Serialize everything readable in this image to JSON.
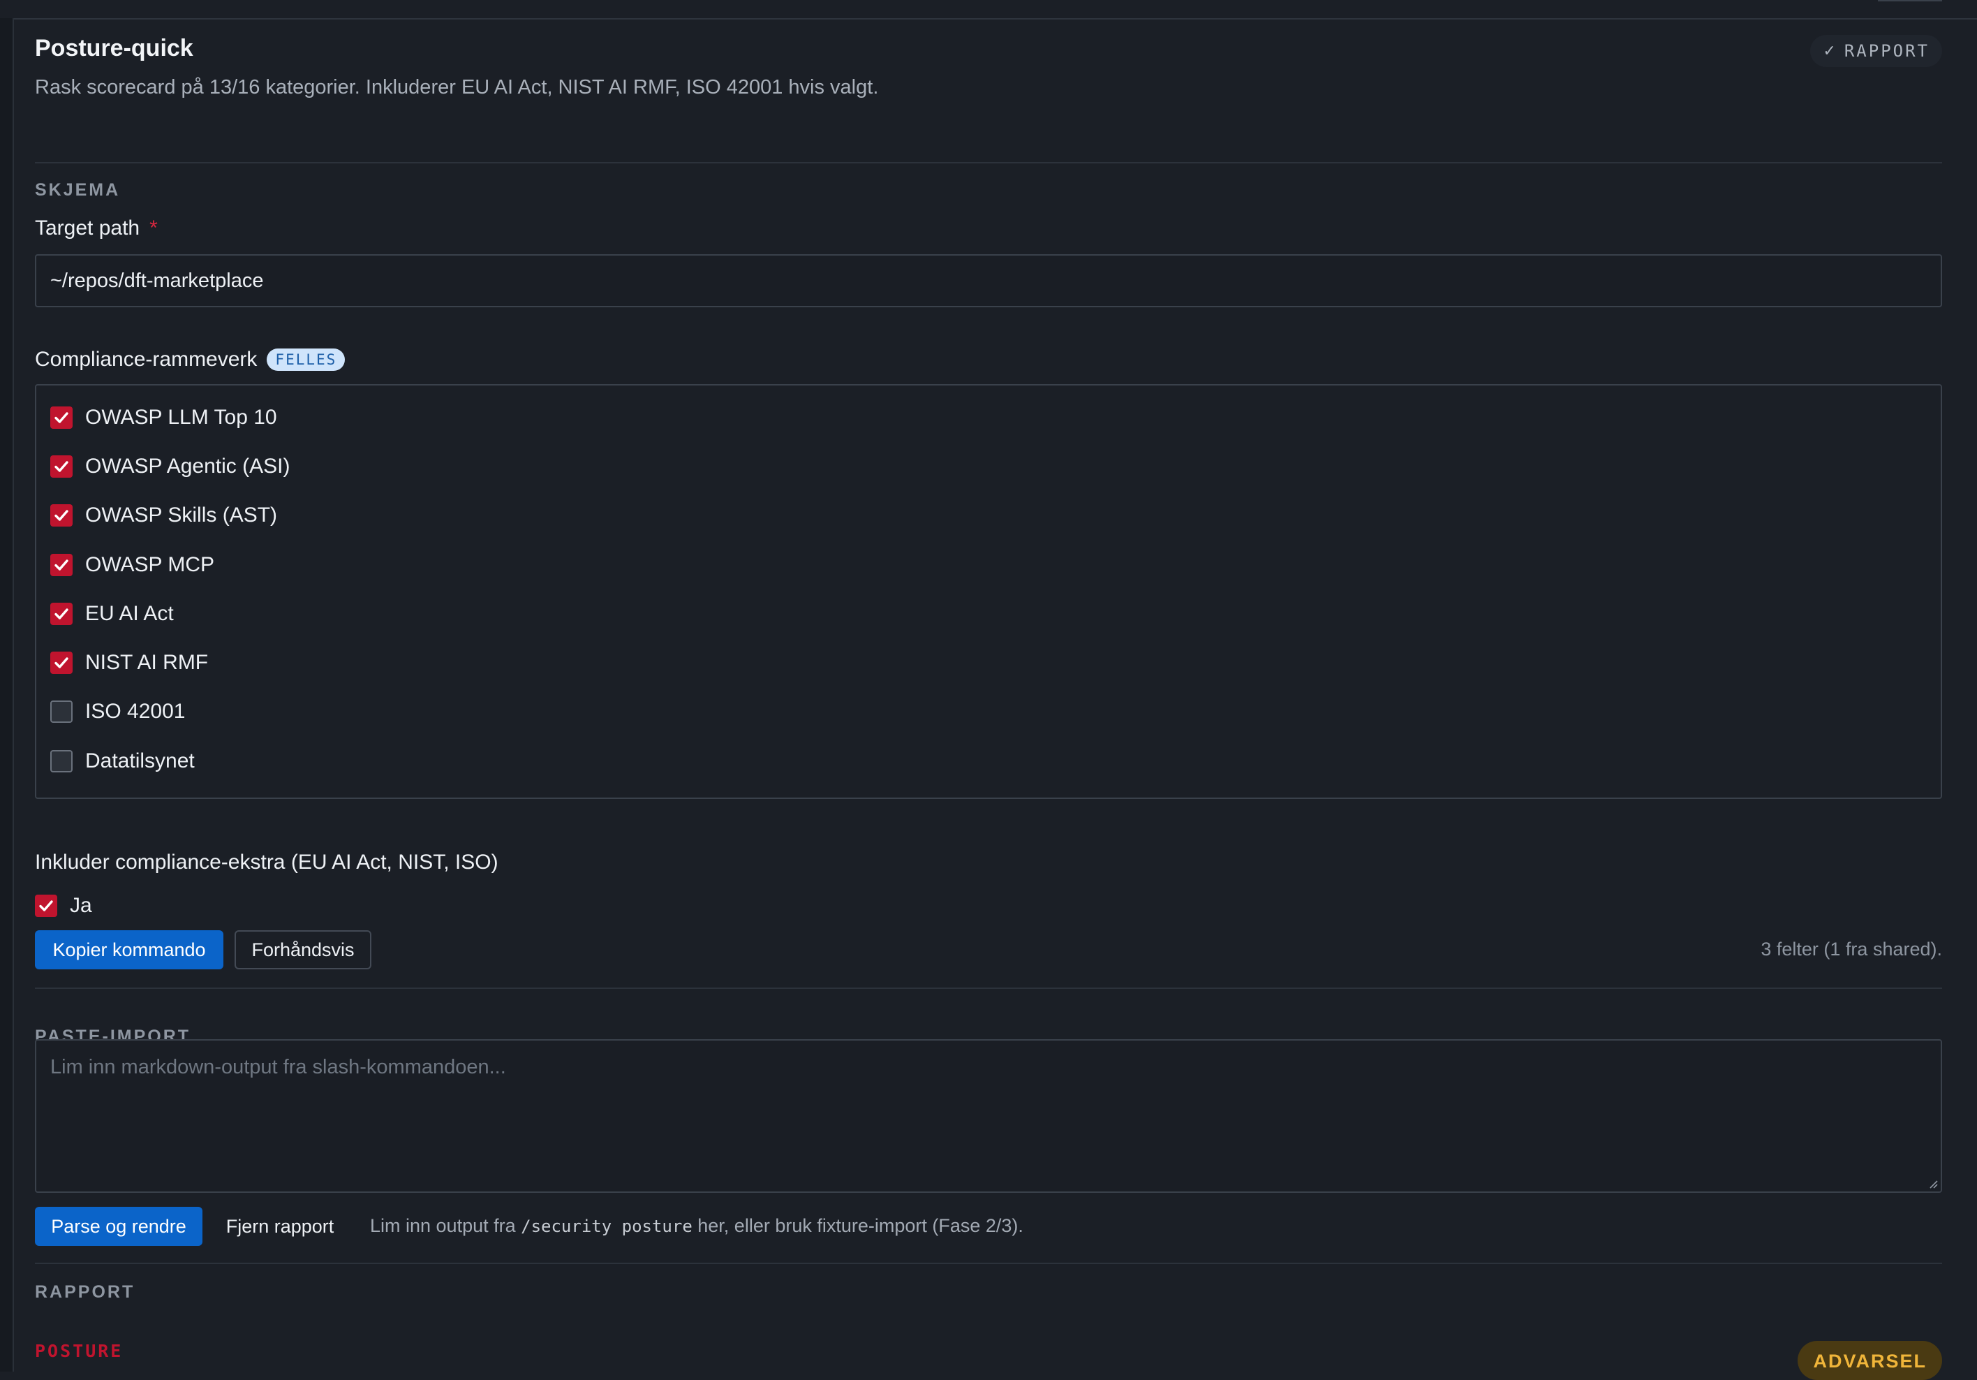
{
  "card": {
    "title": "Posture-quick",
    "subtitle": "Rask scorecard på 13/16 kategorier. Inkluderer EU AI Act, NIST AI RMF, ISO 42001 hvis valgt.",
    "status_badge": {
      "icon": "check-icon",
      "label": "RAPPORT"
    }
  },
  "schema": {
    "section_label": "SKJEMA",
    "target_path": {
      "label": "Target path",
      "required_marker": "*",
      "value": "~/repos/dft-marketplace"
    },
    "frameworks": {
      "label": "Compliance-rammeverk",
      "tag": "FELLES",
      "options": [
        {
          "label": "OWASP LLM Top 10",
          "checked": true
        },
        {
          "label": "OWASP Agentic (ASI)",
          "checked": true
        },
        {
          "label": "OWASP Skills (AST)",
          "checked": true
        },
        {
          "label": "OWASP MCP",
          "checked": true
        },
        {
          "label": "EU AI Act",
          "checked": true
        },
        {
          "label": "NIST AI RMF",
          "checked": true
        },
        {
          "label": "ISO 42001",
          "checked": false
        },
        {
          "label": "Datatilsynet",
          "checked": false
        }
      ]
    },
    "include_extra": {
      "label": "Inkluder compliance-ekstra (EU AI Act, NIST, ISO)",
      "option_label": "Ja",
      "checked": true
    },
    "actions": {
      "copy_label": "Kopier kommando",
      "preview_label": "Forhåndsvis",
      "field_count": "3 felter (1 fra shared)."
    }
  },
  "paste_import": {
    "section_label": "PASTE-IMPORT",
    "placeholder": "Lim inn markdown-output fra slash-kommandoen...",
    "parse_label": "Parse og rendre",
    "remove_label": "Fjern rapport",
    "hint_before": "Lim inn output fra ",
    "hint_code": "/security posture",
    "hint_after": " her, eller bruk fixture-import (Fase 2/3)."
  },
  "report": {
    "section_label": "RAPPORT",
    "posture_label": "POSTURE",
    "severity_badge": "ADVARSEL"
  },
  "colors": {
    "accent_blue": "#0b64c9",
    "checkbox_red": "#c0142e",
    "warning_amber": "#f0b53a"
  }
}
